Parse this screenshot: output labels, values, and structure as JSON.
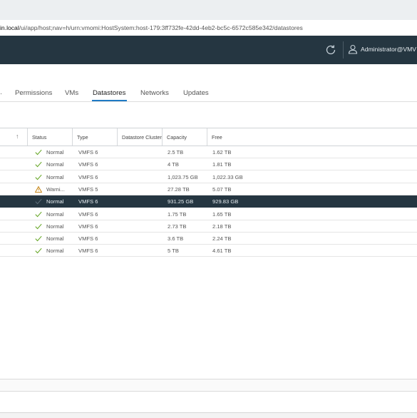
{
  "address": {
    "host": "in.local",
    "path": "/ui/app/host;nav=h/urn:vmomi:HostSystem:host-179:3ff732fe-42dd-4eb2-bc5c-6572c585e342/datastores"
  },
  "header": {
    "username": "Administrator@VMV"
  },
  "tabs": [
    {
      "label": "Permissions"
    },
    {
      "label": "VMs"
    },
    {
      "label": "Datastores",
      "active": true
    },
    {
      "label": "Networks"
    },
    {
      "label": "Updates"
    }
  ],
  "table": {
    "columns": [
      "Status",
      "Type",
      "Datastore Cluster",
      "Capacity",
      "Free"
    ],
    "rows": [
      {
        "status": "Normal",
        "status_icon": "check-icon",
        "type": "VMFS 6",
        "cluster": "",
        "capacity": "2.5 TB",
        "free": "1.62 TB"
      },
      {
        "status": "Normal",
        "status_icon": "check-icon",
        "type": "VMFS 6",
        "cluster": "",
        "capacity": "4 TB",
        "free": "1.81 TB"
      },
      {
        "status": "Normal",
        "status_icon": "check-icon",
        "type": "VMFS 6",
        "cluster": "",
        "capacity": "1,023.75 GB",
        "free": "1,022.33 GB"
      },
      {
        "status": "Warni...",
        "status_icon": "warning-icon",
        "type": "VMFS 5",
        "cluster": "",
        "capacity": "27.28 TB",
        "free": "5.07 TB"
      },
      {
        "status": "Normal",
        "status_icon": "check-icon",
        "type": "VMFS 6",
        "cluster": "",
        "capacity": "931.25 GB",
        "free": "929.83 GB",
        "selected": true
      },
      {
        "status": "Normal",
        "status_icon": "check-icon",
        "type": "VMFS 6",
        "cluster": "",
        "capacity": "1.75 TB",
        "free": "1.65 TB"
      },
      {
        "status": "Normal",
        "status_icon": "check-icon",
        "type": "VMFS 6",
        "cluster": "",
        "capacity": "2.73 TB",
        "free": "2.18 TB"
      },
      {
        "status": "Normal",
        "status_icon": "check-icon",
        "type": "VMFS 6",
        "cluster": "",
        "capacity": "3.6 TB",
        "free": "2.24 TB"
      },
      {
        "status": "Normal",
        "status_icon": "check-icon",
        "type": "VMFS 6",
        "cluster": "",
        "capacity": "5 TB",
        "free": "4.61 TB"
      }
    ]
  },
  "colors": {
    "header_bg": "#253641",
    "accent": "#1f7ac4",
    "check": "#62a420",
    "warning": "#c27b00"
  }
}
